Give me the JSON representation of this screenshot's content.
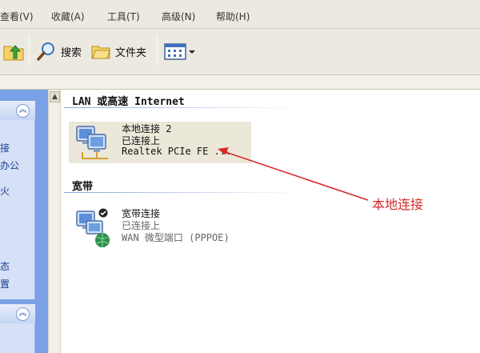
{
  "menubar": {
    "items": [
      "查看(V)",
      "收藏(A)",
      "工具(T)",
      "高级(N)",
      "帮助(H)"
    ]
  },
  "toolbar": {
    "search_label": "搜索",
    "folders_label": "文件夹"
  },
  "taskpane": {
    "fragments": [
      "接",
      "办公",
      "火",
      "态",
      "置"
    ],
    "collapse_glyph": "︽"
  },
  "content": {
    "groups": [
      {
        "header": "LAN 或高速 Internet",
        "items": [
          {
            "name": "本地连接 2",
            "status": "已连接上",
            "device": "Realtek PCIe FE ..."
          }
        ]
      },
      {
        "header": "宽带",
        "items": [
          {
            "name": "宽带连接",
            "status": "已连接上",
            "device": "WAN 微型端口 (PPPOE)"
          }
        ]
      }
    ]
  },
  "annotation": {
    "label": "本地连接",
    "color": "#d62a2a"
  },
  "icons": {
    "up": "folder-up-icon",
    "search": "search-icon",
    "folders": "folders-icon",
    "views": "views-icon",
    "lan": "lan-connection-icon",
    "broadband": "broadband-connection-icon"
  }
}
